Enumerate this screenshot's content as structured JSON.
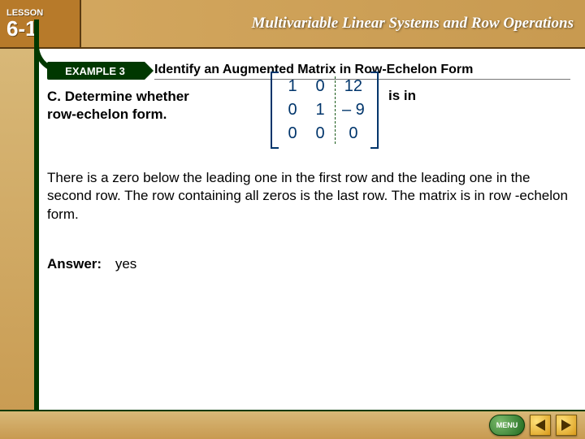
{
  "header": {
    "lesson_label": "LESSON",
    "lesson_number": "6-1",
    "book_title": "Multivariable Linear Systems and Row Operations"
  },
  "example": {
    "badge": "EXAMPLE 3",
    "title": "Identify an Augmented Matrix in Row-Echelon Form"
  },
  "question": {
    "part_label": "C.",
    "lead_in_left": "Determine whether",
    "lead_in_right": "is in",
    "trail": "row-echelon form."
  },
  "matrix": {
    "rows": [
      {
        "c1": "1",
        "c2": "0",
        "aug": "12"
      },
      {
        "c1": "0",
        "c2": "1",
        "aug": "– 9"
      },
      {
        "c1": "0",
        "c2": "0",
        "aug": "0"
      }
    ]
  },
  "explanation": "There is a zero below the leading one in the first row and the leading one in the second row. The row containing all zeros is the last row. The matrix is in row -echelon form.",
  "answer": {
    "label": "Answer:",
    "value": "yes"
  },
  "footer": {
    "menu": "MENU"
  }
}
